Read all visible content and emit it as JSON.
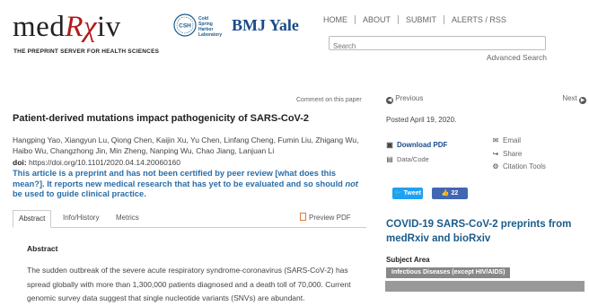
{
  "header": {
    "logo_prefix": "med",
    "logo_rx": "Rχ",
    "logo_suffix": "iv",
    "tagline": "THE PREPRINT SERVER FOR HEALTH SCIENCES",
    "csh_badge": "CSH",
    "csh_line1": "Cold",
    "csh_line2": "Spring",
    "csh_line3": "Harbor",
    "csh_line4": "Laboratory",
    "bmj": "BMJ Yale",
    "nav": [
      "HOME",
      "ABOUT",
      "SUBMIT",
      "ALERTS / RSS"
    ],
    "search_placeholder": "Search",
    "advanced_search": "Advanced Search"
  },
  "article": {
    "comment_link": "Comment on this paper",
    "title": "Patient-derived mutations impact pathogenicity of SARS-CoV-2",
    "authors": "Hangping Yao, Xiangyun Lu, Qiong Chen, Kaijin Xu, Yu Chen, Linfang Cheng, Fumin Liu, Zhigang Wu, Haibo Wu, Changzhong Jin, Min Zheng, Nanping Wu, Chao Jiang, Lanjuan Li",
    "doi_label": "doi:",
    "doi_value": "https://doi.org/10.1101/2020.04.14.20060160",
    "warning_part1": "This article is a preprint and has not been certified by peer review [what does this mean?]. It reports new medical research that has yet to be evaluated and so should ",
    "warning_not": "not",
    "warning_part2": " be used to guide clinical practice.",
    "tabs": [
      "Abstract",
      "Info/History",
      "Metrics"
    ],
    "preview_pdf": "Preview PDF",
    "abstract_heading": "Abstract",
    "abstract_text": "The sudden outbreak of the severe acute respiratory syndrome-coronavirus (SARS-CoV-2) has spread globally with more than 1,300,000 patients diagnosed and a death toll of 70,000. Current genomic survey data suggest that single nucleotide variants (SNVs) are abundant."
  },
  "sidebar": {
    "previous": "Previous",
    "next": "Next",
    "posted": "Posted April 19, 2020.",
    "download_pdf": "Download PDF",
    "data_code": "Data/Code",
    "email": "Email",
    "share": "Share",
    "citation_tools": "Citation Tools",
    "tweet": "Tweet",
    "like": "22",
    "covid_heading": "COVID-19 SARS-CoV-2 preprints from medRxiv and bioRxiv",
    "subject_area_heading": "Subject Area",
    "subject_area": "Infectious Diseases (except HIV/AIDS)"
  },
  "colors": {
    "brand_red": "#b31b1b",
    "link_blue": "#2a6ea8",
    "heading_blue": "#1b5c8a",
    "tweet_blue": "#1da1f2",
    "facebook_blue": "#4267b2"
  }
}
